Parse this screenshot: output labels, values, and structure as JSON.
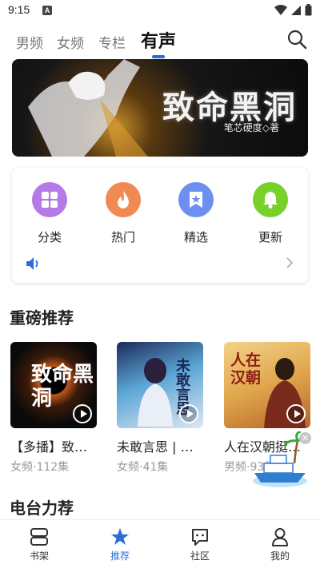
{
  "status_bar": {
    "time": "9:15",
    "notification_letter": "A"
  },
  "top_nav": {
    "tabs": [
      {
        "label": "男频",
        "active": false
      },
      {
        "label": "女频",
        "active": false
      },
      {
        "label": "专栏",
        "active": false
      },
      {
        "label": "有声",
        "active": true
      }
    ],
    "icon": "search-icon"
  },
  "banner": {
    "title": "致命黑洞",
    "author": "笔芯硬度◇著"
  },
  "categories": [
    {
      "label": "分类",
      "icon": "grid-icon",
      "color": "#b57ae8"
    },
    {
      "label": "热门",
      "icon": "flame-icon",
      "color": "#f08a52"
    },
    {
      "label": "精选",
      "icon": "star-bookmark-icon",
      "color": "#6d8ff0"
    },
    {
      "label": "更新",
      "icon": "bell-icon",
      "color": "#78d12b"
    }
  ],
  "featured": {
    "title": "重磅推荐",
    "books": [
      {
        "title": "【多播】致…",
        "meta": "女频·112集",
        "cover_text": "致命黑洞"
      },
      {
        "title": "未敢言思 | …",
        "meta": "女频·41集",
        "cover_text": "未敢言思"
      },
      {
        "title": "人在汉朝挺…",
        "meta": "男频·93集",
        "cover_text": "人在汉朝"
      }
    ]
  },
  "radio_section": {
    "title": "电台力荐"
  },
  "bottom_nav": {
    "items": [
      {
        "label": "书架",
        "icon": "bookshelf-icon",
        "active": false
      },
      {
        "label": "推荐",
        "icon": "star-icon",
        "active": true
      },
      {
        "label": "社区",
        "icon": "chat-icon",
        "active": false
      },
      {
        "label": "我的",
        "icon": "user-icon",
        "active": false
      }
    ]
  },
  "colors": {
    "accent": "#2b6fd6",
    "text": "#222222",
    "muted": "#999999"
  }
}
